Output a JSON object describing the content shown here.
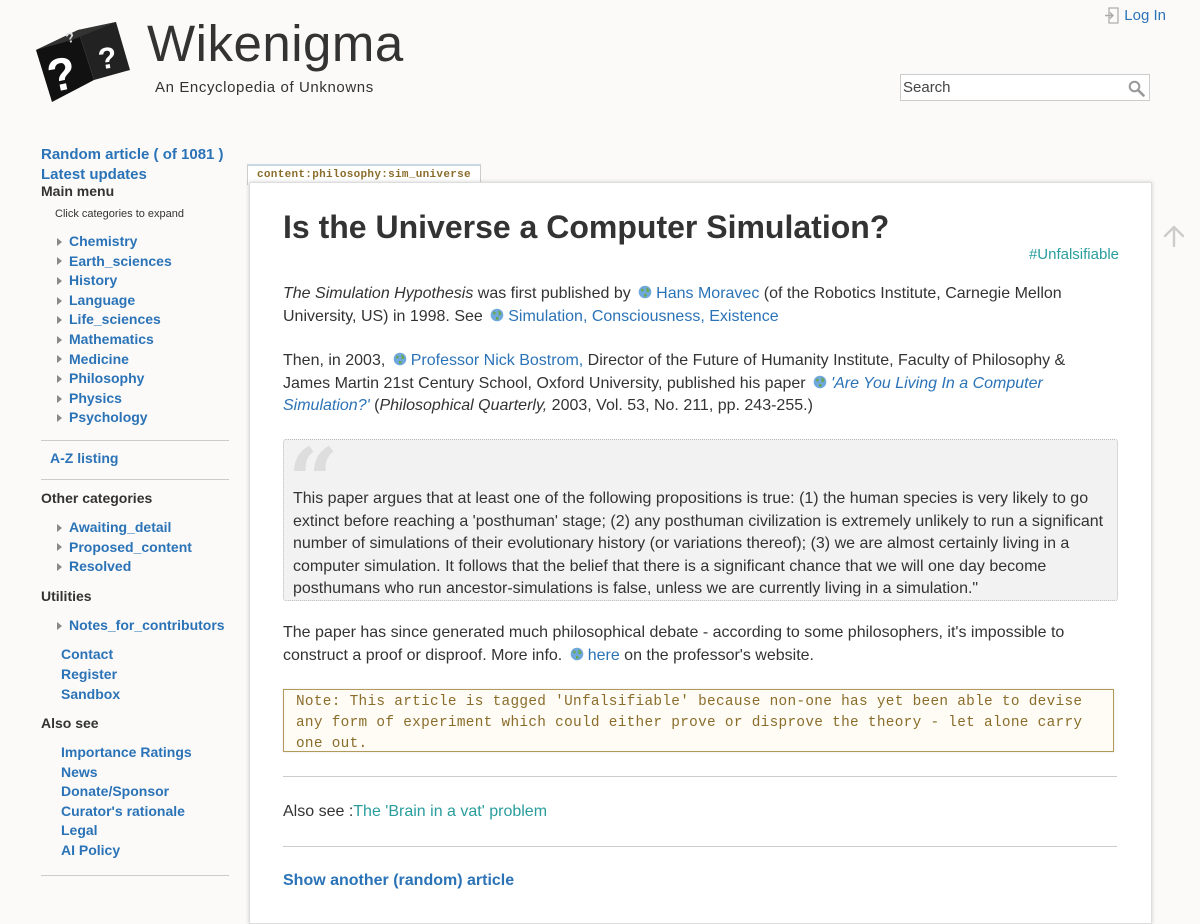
{
  "site": {
    "title": "Wikenigma",
    "tagline": "An Encyclopedia of Unknowns",
    "login_label": "Log In",
    "search_placeholder": "Search"
  },
  "sidebar": {
    "random_article": "Random article ( of 1081 )",
    "latest_updates": "Latest updates",
    "main_menu_heading": "Main menu",
    "expand_note": "Click categories to expand",
    "categories": [
      "Chemistry",
      "Earth_sciences",
      "History",
      "Language",
      "Life_sciences",
      "Mathematics",
      "Medicine",
      "Philosophy",
      "Physics",
      "Psychology"
    ],
    "az_listing": "A-Z listing",
    "other_heading": "Other categories",
    "other_categories": [
      "Awaiting_detail",
      "Proposed_content",
      "Resolved"
    ],
    "utilities_heading": "Utilities",
    "utilities_expandable": "Notes_for_contributors",
    "utilities": [
      "Contact",
      "Register",
      "Sandbox"
    ],
    "also_see_heading": "Also see",
    "also_see": [
      "Importance Ratings",
      "News",
      "Donate/Sponsor",
      "Curator's rationale",
      "Legal",
      "AI Policy"
    ]
  },
  "page": {
    "tab_label": "content:philosophy:sim_universe",
    "title": "Is the Universe a Computer Simulation?",
    "tag": "#Unfalsifiable",
    "p1": {
      "italic_lead": "The Simulation Hypothesis",
      "t1": " was first published by ",
      "link1": "Hans Moravec",
      "t2": " (of the Robotics Institute, Carnegie Mellon University, US) in 1998. See ",
      "link2": "Simulation, Consciousness, Existence"
    },
    "p2": {
      "t1": "Then, in 2003, ",
      "link1": "Professor Nick Bostrom,",
      "t2": " Director of the Future of Humanity Institute, Faculty of Philosophy & James Martin 21st Century School, Oxford University, published his paper ",
      "link2": "'Are You Living In a Computer Simulation?'",
      "t3": " (",
      "journal": "Philosophical Quarterly,",
      "t4": " 2003, Vol. 53, No. 211, pp. 243-255.)"
    },
    "quote": "This paper argues that at least one of the following propositions is true: (1) the human species is very likely to go extinct before reaching a 'posthuman' stage; (2) any posthuman civilization is extremely unlikely to run a significant number of simulations of their evolutionary history (or variations thereof); (3) we are almost certainly living in a computer simulation. It follows that the belief that there is a significant chance that we will one day become posthumans who run ancestor-simulations is false, unless we are currently living in a simulation.\"",
    "p3": {
      "t1": "The paper has since generated much philosophical debate - according to some philosophers, it's impossible to construct a proof or disproof. More info. ",
      "link": "here",
      "t2": " on the professor's website."
    },
    "note": "Note: This article is tagged 'Unfalsifiable' because non-one has yet been able to devise any form of experiment which could either prove or disprove the theory - let alone carry one out.",
    "also_see_label": "Also see :",
    "also_see_link": "The 'Brain in a vat' problem",
    "show_random": "Show another (random) article"
  },
  "icons": {
    "logo": "question-cube-logo",
    "login": "login-icon",
    "search": "search-icon",
    "external": "globe-icon",
    "back_to_top": "arrow-up-icon"
  },
  "colors": {
    "link": "#2b73b7",
    "tag": "#2a9d9d",
    "note_text": "#8a6d2b"
  }
}
